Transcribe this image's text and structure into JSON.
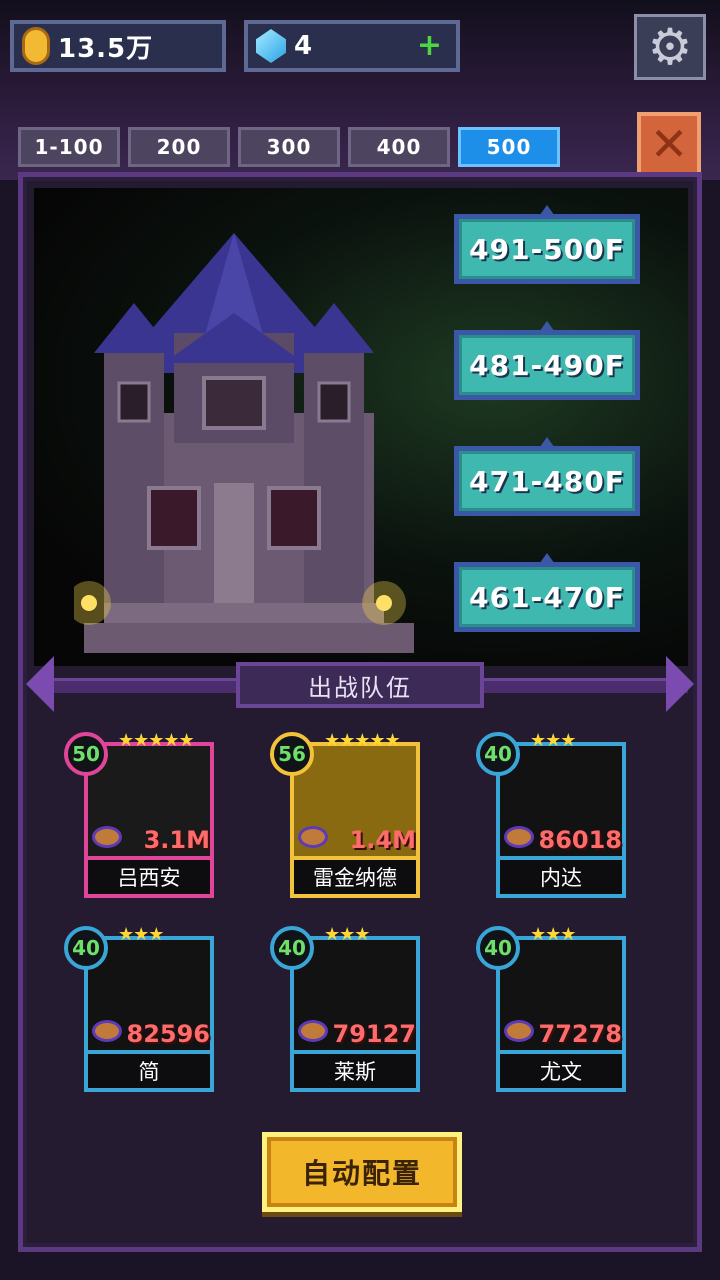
{
  "resources": {
    "gold": "13.5万",
    "gold_icon": "gold-coin-icon",
    "gems": "4",
    "gem_icon": "blue-crystal-icon",
    "plus": "+"
  },
  "settings_icon": "⚙",
  "close_icon": "✕",
  "tabs": [
    {
      "label": "1-100",
      "active": false
    },
    {
      "label": "200",
      "active": false
    },
    {
      "label": "300",
      "active": false
    },
    {
      "label": "400",
      "active": false
    },
    {
      "label": "500",
      "active": true
    }
  ],
  "floors": [
    "491-500F",
    "481-490F",
    "471-480F",
    "461-470F"
  ],
  "team_title": "出战队伍",
  "team": [
    {
      "level": "50",
      "stars": "★★★★★",
      "power": "3.1M",
      "name": "吕西安",
      "frame": "#e0459a",
      "bg": "#1a1a1a"
    },
    {
      "level": "56",
      "stars": "★★★★★",
      "power": "1.4M",
      "name": "雷金纳德",
      "frame": "#f2c33a",
      "bg": "#8a6a10"
    },
    {
      "level": "40",
      "stars": "★★★",
      "power": "86018",
      "name": "内达",
      "frame": "#3aa6d8",
      "bg": "#121212"
    },
    {
      "level": "40",
      "stars": "★★★",
      "power": "82596",
      "name": "简",
      "frame": "#3aa6d8",
      "bg": "#121212"
    },
    {
      "level": "40",
      "stars": "★★★",
      "power": "79127",
      "name": "莱斯",
      "frame": "#3aa6d8",
      "bg": "#121212"
    },
    {
      "level": "40",
      "stars": "★★★",
      "power": "77278",
      "name": "尤文",
      "frame": "#3aa6d8",
      "bg": "#121212"
    }
  ],
  "auto_button": "自动配置"
}
